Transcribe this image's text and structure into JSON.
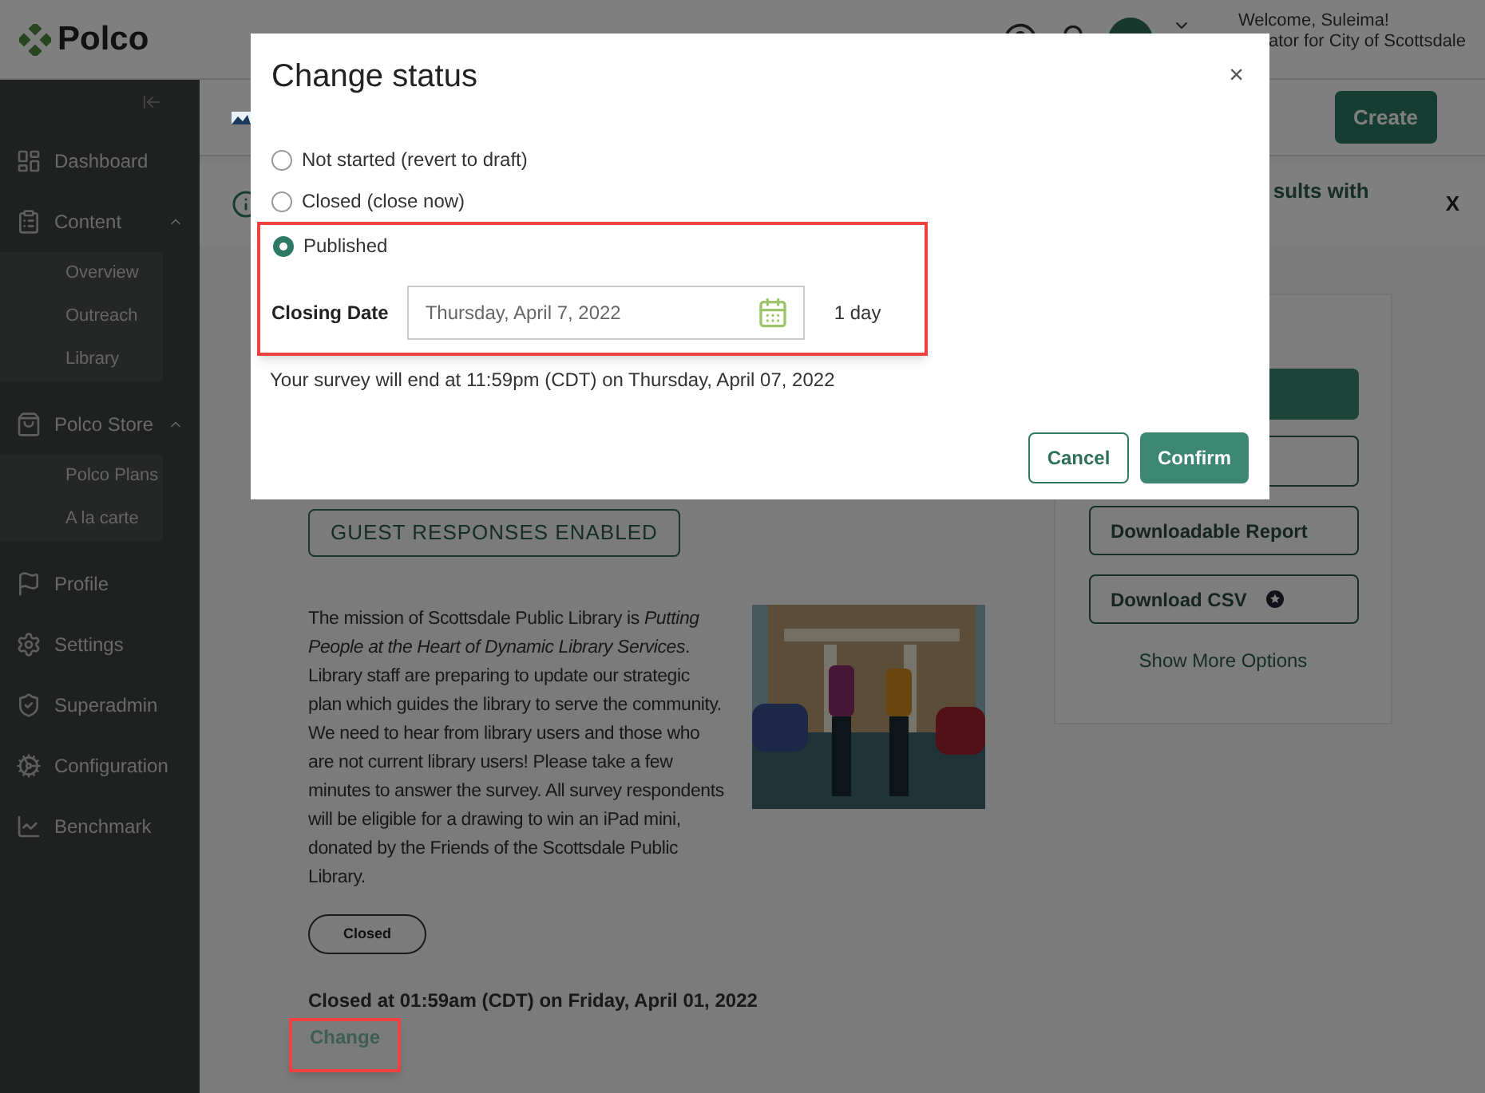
{
  "header": {
    "logo": "Polco",
    "welcome": "Welcome, Suleima!",
    "role": "ator for City of Scottsdale"
  },
  "sidebar": {
    "items": [
      {
        "label": "Dashboard"
      },
      {
        "label": "Content",
        "expanded": true,
        "children": [
          {
            "label": "Overview"
          },
          {
            "label": "Outreach"
          },
          {
            "label": "Library"
          }
        ]
      },
      {
        "label": "Polco Store",
        "expanded": true,
        "children": [
          {
            "label": "Polco Plans"
          },
          {
            "label": "A la carte"
          }
        ]
      },
      {
        "label": "Profile"
      },
      {
        "label": "Settings"
      },
      {
        "label": "Superadmin"
      },
      {
        "label": "Configuration"
      },
      {
        "label": "Benchmark"
      }
    ]
  },
  "toolbar": {
    "create_button": "Create"
  },
  "banner": {
    "text": "sults with",
    "dismiss": "X"
  },
  "survey": {
    "badge": "GUEST RESPONSES ENABLED",
    "description": "The mission of Scottsdale Public Library is *Putting People at the Heart of Dynamic Library Services*. Library staff are preparing to update our strategic plan which guides the library to serve the community. We need to hear from library users and those who are not current library users! Please take a few minutes to answer the survey. All survey respondents will be eligible for a drawing to win an iPad mini, donated by the Friends of the Scottsdale Public Library.",
    "status": "Closed",
    "closed_info": "Closed at 01:59am (CDT) on Friday, April 01, 2022",
    "change_link": {
      "label": "Change",
      "highlighted": true
    }
  },
  "actions": {
    "buttons": [
      {
        "label": "Downloadable Report",
        "kind": "plain"
      },
      {
        "label": "Download CSV",
        "kind": "premium"
      }
    ],
    "more": "Show More Options"
  },
  "modal": {
    "title": "Change status",
    "close": "×",
    "options": [
      {
        "label": "Not started (revert to draft)",
        "selected": false
      },
      {
        "label": "Closed (close now)",
        "selected": false
      },
      {
        "label": "Published",
        "selected": true
      }
    ],
    "closing_date": {
      "label": "Closing Date",
      "value": "Thursday, April 7, 2022",
      "duration": "1 day",
      "highlighted": true
    },
    "note": "Your survey will end at 11:59pm (CDT) on Thursday, April 07, 2022",
    "cancel": "Cancel",
    "confirm": "Confirm"
  }
}
